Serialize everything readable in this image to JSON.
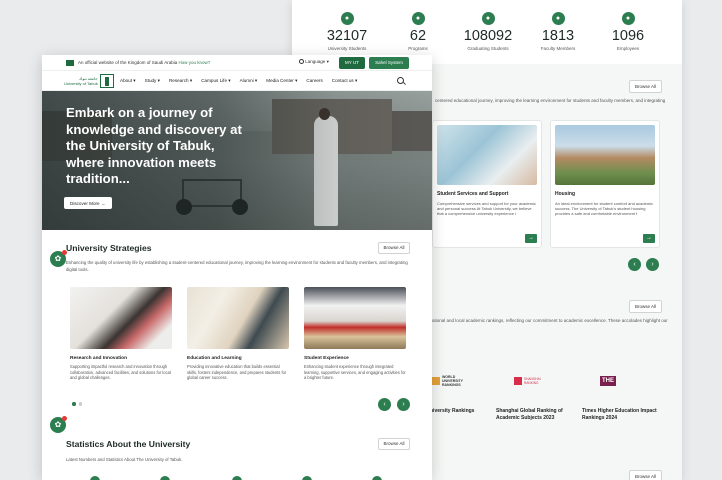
{
  "bg": {
    "stats": [
      {
        "icon": "student-icon",
        "value": "32107",
        "label": "University Students"
      },
      {
        "icon": "programs-icon",
        "value": "62",
        "label": "Programs"
      },
      {
        "icon": "graduate-icon",
        "value": "108092",
        "label": "Graduating Students"
      },
      {
        "icon": "faculty-icon",
        "value": "1813",
        "label": "Faculty Members"
      },
      {
        "icon": "employees-icon",
        "value": "1096",
        "label": "Employees"
      }
    ],
    "browse_all": "Browse All",
    "services_desc": "centered educational journey, improving the learning environment for students and faculty members, and integrating",
    "services": [
      {
        "title": "Student Services and Support",
        "desc": "Comprehensive services and support for your academic and personal success At Tabuk University, we believe that a comprehensive university experience i"
      },
      {
        "title": "Housing",
        "desc": "An ideal environment for student comfort and academic success. The University of Tabuk's student housing provides a safe and comfortable environment f"
      }
    ],
    "rankings_desc": "ational and local academic rankings, reflecting our commitment to academic excellence. These accolades highlight our",
    "rankings": [
      {
        "label": "niversity Rankings",
        "logo": "WORLD UNIVERSITY RANKINGS"
      },
      {
        "label": "Shanghai Global Ranking of Academic Subjects 2023",
        "logo": "SHANGHAI RANKING"
      },
      {
        "label": "Times Higher Education Impact Rankings 2024",
        "logo": "THE"
      }
    ]
  },
  "topbar": {
    "official": "An official website of the Kingdom of Saudi Arabia",
    "how_know": "How you know?",
    "language": "Language",
    "my_ut": "MY UT",
    "sahel": "Sahel System"
  },
  "nav": {
    "logo_text_ar": "جامعة تبوك",
    "logo_text_en": "University of Tabuk",
    "items": [
      "About",
      "Study",
      "Research",
      "Campus Life",
      "Alumni",
      "Media Center",
      "Careers",
      "Contact us"
    ]
  },
  "hero": {
    "title": "Embark on a journey of knowledge and discovery at the University of Tabuk, where innovation meets tradition...",
    "button": "Discover More"
  },
  "strategies": {
    "title": "University Strategies",
    "browse": "Browse All",
    "desc": "Enhancing the quality of university life by establishing a student-centered educational journey, improving the learning environment for students and faculty members, and integrating digital tools.",
    "cards": [
      {
        "title": "Research and Innovation",
        "desc": "Supporting impactful research and innovation through collaboration, advanced facilities, and solutions for local and global challenges."
      },
      {
        "title": "Education and Learning",
        "desc": "Providing innovative education that builds essential skills, fosters independence, and prepares students for global career success."
      },
      {
        "title": "Student Experience",
        "desc": "Enhancing student experience through integrated learning, supportive services, and engaging activities for a brighter future."
      }
    ]
  },
  "statistics": {
    "title": "Statistics About the University",
    "browse": "Browse All",
    "desc": "Latest Numbers and Statistics About The University of Tabuk."
  },
  "colors": {
    "brand": "#2c7d4f",
    "brand_dark": "#1f6b3f"
  }
}
